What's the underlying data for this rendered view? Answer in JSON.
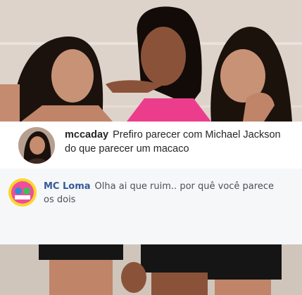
{
  "instagram_comment": {
    "username": "mccaday",
    "text": "Prefiro parecer com Michael Jackson do que parecer um macaco"
  },
  "facebook_comment": {
    "username": "MC Loma",
    "text": "Olha ai que ruim.. por quê você parece os dois"
  },
  "colors": {
    "fb_name": "#365899",
    "ig_text": "#262626",
    "card_bg": "#ffffff",
    "fb_card_bg": "#f6f7f9"
  }
}
